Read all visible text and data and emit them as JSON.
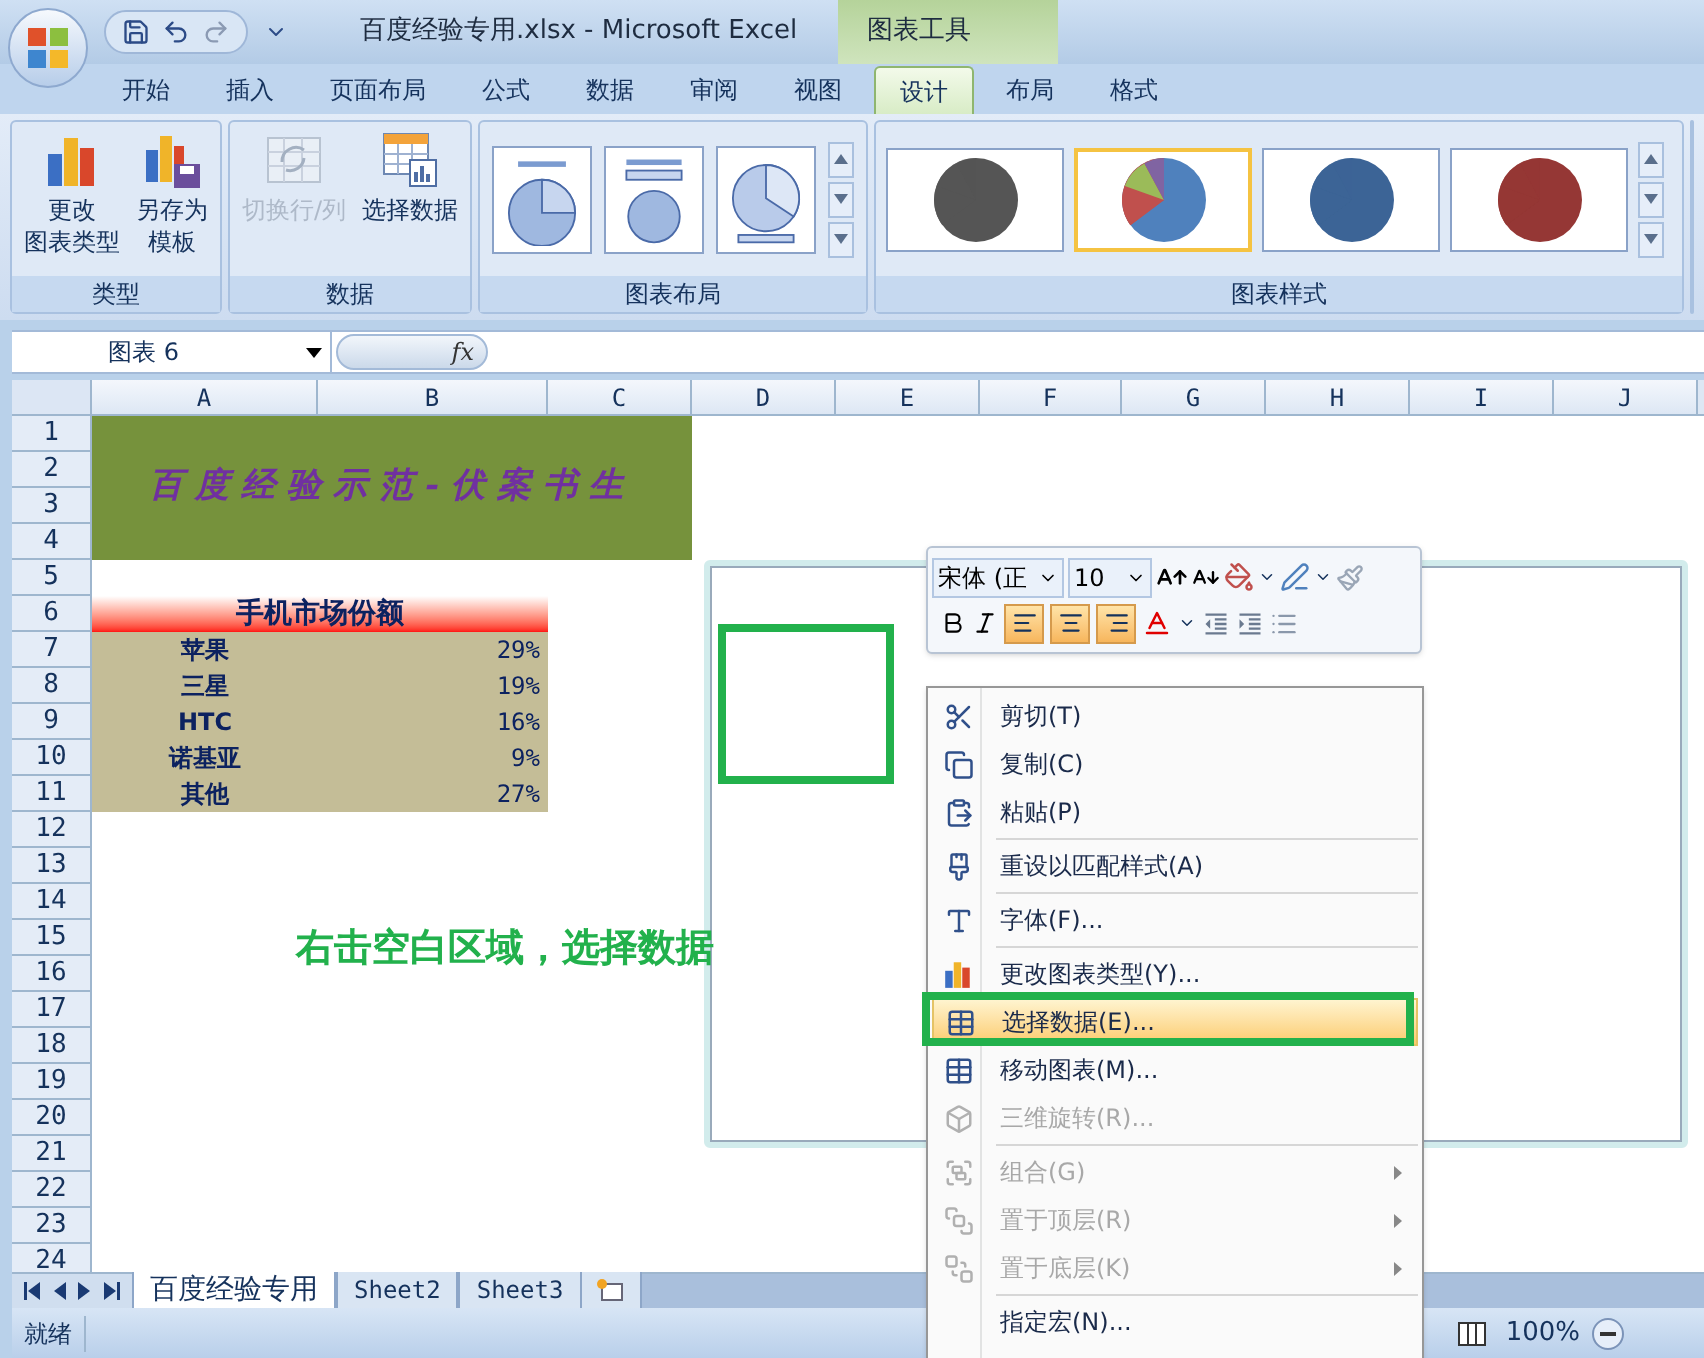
{
  "window": {
    "title": "百度经验专用.xlsx - Microsoft Excel",
    "context_title": "图表工具"
  },
  "ribbon_tabs": [
    {
      "label": "开始",
      "selected": false
    },
    {
      "label": "插入",
      "selected": false
    },
    {
      "label": "页面布局",
      "selected": false
    },
    {
      "label": "公式",
      "selected": false
    },
    {
      "label": "数据",
      "selected": false
    },
    {
      "label": "审阅",
      "selected": false
    },
    {
      "label": "视图",
      "selected": false
    },
    {
      "label": "设计",
      "selected": true
    },
    {
      "label": "布局",
      "selected": false
    },
    {
      "label": "格式",
      "selected": false
    }
  ],
  "ribbon_groups": [
    {
      "label": "类型",
      "buttons": [
        {
          "label_lines": [
            "更改",
            "图表类型"
          ],
          "kind": "chart-type",
          "disabled": false
        },
        {
          "label_lines": [
            "另存为",
            "模板"
          ],
          "kind": "save-template",
          "disabled": false
        }
      ]
    },
    {
      "label": "数据",
      "buttons": [
        {
          "label_lines": [
            "切换行/列"
          ],
          "kind": "switch",
          "disabled": true
        },
        {
          "label_lines": [
            "选择数据"
          ],
          "kind": "select-data",
          "disabled": false
        }
      ]
    }
  ],
  "chart_layouts": {
    "label": "图表布局",
    "items": [
      {
        "kind": "labels"
      },
      {
        "kind": "legend"
      },
      {
        "kind": "plain"
      }
    ]
  },
  "chart_styles": {
    "label": "图表样式",
    "items": [
      {
        "color": "#555555",
        "selected": false
      },
      {
        "color": "#4f81bd",
        "selected": true
      },
      {
        "color": "#3c6496",
        "selected": false
      },
      {
        "color": "#953735",
        "selected": false
      }
    ]
  },
  "name_box": "图表 6",
  "function_label": "fx",
  "columns": [
    "A",
    "B",
    "C",
    "D",
    "E",
    "F",
    "G",
    "H",
    "I",
    "J"
  ],
  "rows": [
    "1",
    "2",
    "3",
    "4",
    "5",
    "6",
    "7",
    "8",
    "9",
    "10",
    "11",
    "12",
    "13",
    "14",
    "15",
    "16",
    "17",
    "18",
    "19",
    "20",
    "21",
    "22",
    "23",
    "24"
  ],
  "banner": "百度经验示范-伏案书生",
  "table": {
    "title": "手机市场份额",
    "rows": [
      {
        "name": "苹果",
        "share": "29%"
      },
      {
        "name": "三星",
        "share": "19%"
      },
      {
        "name": "HTC",
        "share": "16%"
      },
      {
        "name": "诺基亚",
        "share": "9%"
      },
      {
        "name": "其他",
        "share": "27%"
      }
    ]
  },
  "annotation": "右击空白区域，选择数据",
  "mini_toolbar": {
    "font": "宋体 (正",
    "size": "10"
  },
  "context_menu": [
    {
      "label": "剪切(T)",
      "kind": "cut",
      "disabled": false,
      "selected": false,
      "submenu": false,
      "separator_before": false
    },
    {
      "label": "复制(C)",
      "kind": "copy",
      "disabled": false,
      "selected": false,
      "submenu": false,
      "separator_before": false
    },
    {
      "label": "粘贴(P)",
      "kind": "paste",
      "disabled": false,
      "selected": false,
      "submenu": false,
      "separator_before": false
    },
    {
      "label": "重设以匹配样式(A)",
      "kind": "reset",
      "disabled": false,
      "selected": false,
      "submenu": false,
      "separator_before": true
    },
    {
      "label": "字体(F)...",
      "kind": "font",
      "disabled": false,
      "selected": false,
      "submenu": false,
      "separator_before": true
    },
    {
      "label": "更改图表类型(Y)...",
      "kind": "chart-type",
      "disabled": false,
      "selected": false,
      "submenu": false,
      "separator_before": true
    },
    {
      "label": "选择数据(E)...",
      "kind": "select-data",
      "disabled": false,
      "selected": true,
      "submenu": false,
      "separator_before": false
    },
    {
      "label": "移动图表(M)...",
      "kind": "move-chart",
      "disabled": false,
      "selected": false,
      "submenu": false,
      "separator_before": false
    },
    {
      "label": "三维旋转(R)...",
      "kind": "rotate",
      "disabled": true,
      "selected": false,
      "submenu": false,
      "separator_before": false
    },
    {
      "label": "组合(G)",
      "kind": "group",
      "disabled": true,
      "selected": false,
      "submenu": true,
      "separator_before": true
    },
    {
      "label": "置于顶层(R)",
      "kind": "front",
      "disabled": true,
      "selected": false,
      "submenu": true,
      "separator_before": false
    },
    {
      "label": "置于底层(K)",
      "kind": "back",
      "disabled": true,
      "selected": false,
      "submenu": true,
      "separator_before": false
    },
    {
      "label": "指定宏(N)...",
      "kind": "macro",
      "disabled": false,
      "selected": false,
      "submenu": false,
      "separator_before": true
    }
  ],
  "sheet_tabs": [
    {
      "label": "百度经验专用",
      "selected": true
    },
    {
      "label": "Sheet2",
      "selected": false
    },
    {
      "label": "Sheet3",
      "selected": false
    }
  ],
  "status_bar": {
    "status": "就绪",
    "zoom": "100%"
  }
}
